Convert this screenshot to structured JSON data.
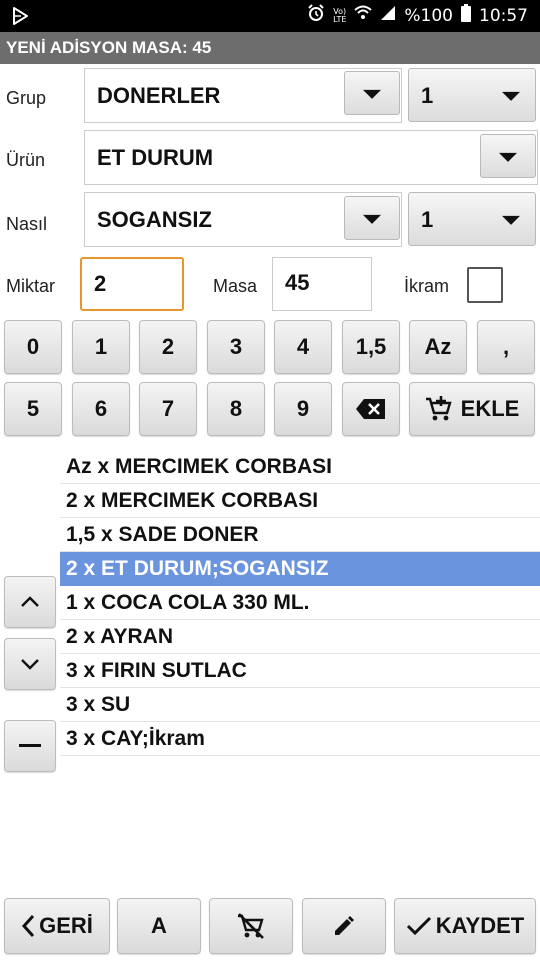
{
  "statusbar": {
    "battery": "%100",
    "time": "10:57",
    "volte_top": "Vo)",
    "volte_bottom": "LTE"
  },
  "window": {
    "title": "YENİ ADİSYON MASA: 45"
  },
  "form": {
    "grup": {
      "label": "Grup",
      "value": "DONERLER",
      "qty": "1"
    },
    "urun": {
      "label": "Ürün",
      "value": "ET DURUM"
    },
    "nasil": {
      "label": "Nasıl",
      "value": "SOGANSIZ",
      "qty": "1"
    },
    "miktar": {
      "label": "Miktar",
      "value": "2"
    },
    "masa": {
      "label": "Masa",
      "value": "45"
    },
    "ikram": {
      "label": "İkram",
      "checked": false
    }
  },
  "keypad": {
    "row1": [
      "0",
      "1",
      "2",
      "3",
      "4",
      "1,5",
      "Az",
      ","
    ],
    "row2": [
      "5",
      "6",
      "7",
      "8",
      "9"
    ],
    "add_label": "EKLE"
  },
  "order_items": [
    "Az x MERCIMEK CORBASI",
    "2 x MERCIMEK CORBASI",
    "1,5 x SADE DONER",
    "2 x ET DURUM;SOGANSIZ",
    "1 x COCA COLA 330 ML.",
    "2 x AYRAN",
    "3 x FIRIN SUTLAC",
    "3 x SU",
    "3 x CAY;İkram"
  ],
  "selected_index": 3,
  "bottom": {
    "back_label": "GERİ",
    "a_label": "A",
    "save_label": "KAYDET"
  },
  "colors": {
    "selection": "#6b94df",
    "titlebar": "#6d6d6d",
    "focus_border": "#e8962b"
  }
}
